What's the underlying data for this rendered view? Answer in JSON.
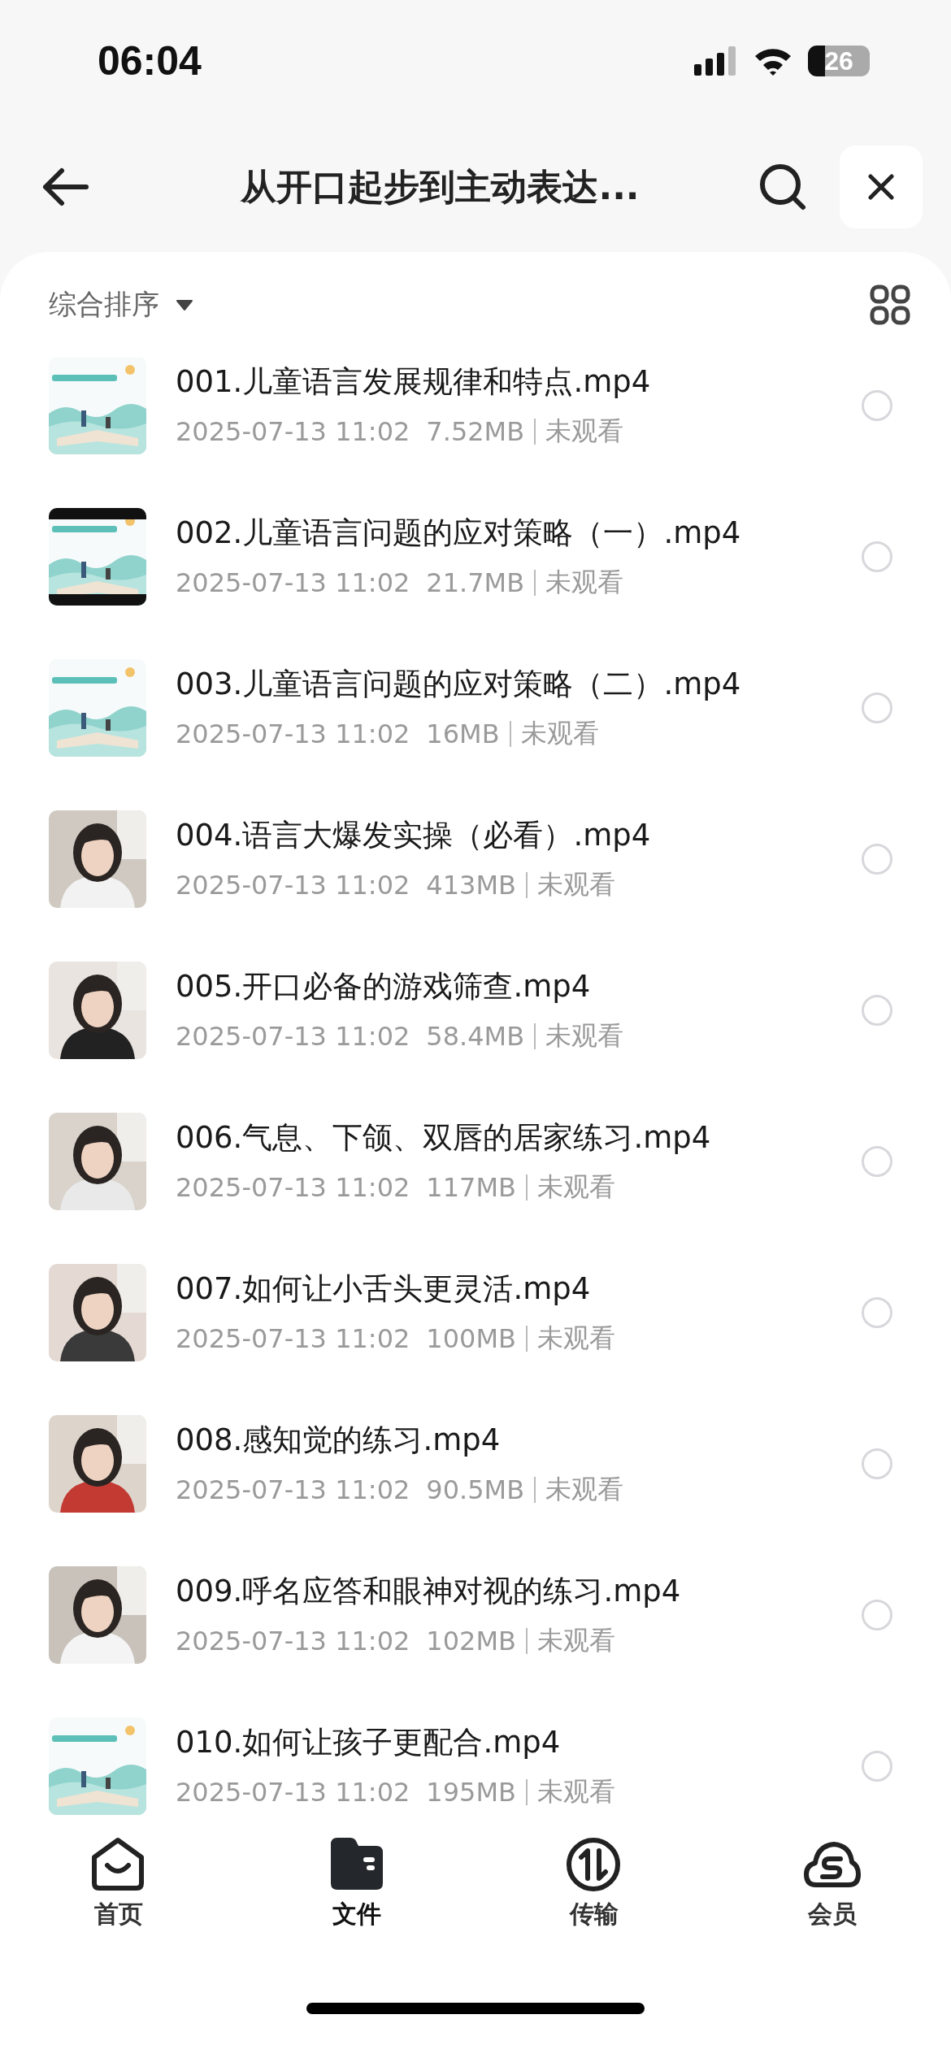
{
  "status_bar": {
    "time": "06:04",
    "battery": "26"
  },
  "header": {
    "title": "从开口起步到主动表达..."
  },
  "sort": {
    "label": "综合排序"
  },
  "files": [
    {
      "name": "001.儿童语言发展规律和特点.mp4",
      "date": "2025-07-13 11:02",
      "size": "7.52MB",
      "status": "未观看",
      "selected": false
    },
    {
      "name": "002.儿童语言问题的应对策略（一）.mp4",
      "date": "2025-07-13 11:02",
      "size": "21.7MB",
      "status": "未观看",
      "selected": false
    },
    {
      "name": "003.儿童语言问题的应对策略（二）.mp4",
      "date": "2025-07-13 11:02",
      "size": "16MB",
      "status": "未观看",
      "selected": false
    },
    {
      "name": "004.语言大爆发实操（必看）.mp4",
      "date": "2025-07-13 11:02",
      "size": "413MB",
      "status": "未观看",
      "selected": false
    },
    {
      "name": "005.开口必备的游戏筛查.mp4",
      "date": "2025-07-13 11:02",
      "size": "58.4MB",
      "status": "未观看",
      "selected": false
    },
    {
      "name": "006.气息、下颌、双唇的居家练习.mp4",
      "date": "2025-07-13 11:02",
      "size": "117MB",
      "status": "未观看",
      "selected": false
    },
    {
      "name": "007.如何让小舌头更灵活.mp4",
      "date": "2025-07-13 11:02",
      "size": "100MB",
      "status": "未观看",
      "selected": false
    },
    {
      "name": "008.感知觉的练习.mp4",
      "date": "2025-07-13 11:02",
      "size": "90.5MB",
      "status": "未观看",
      "selected": false
    },
    {
      "name": "009.呼名应答和眼神对视的练习.mp4",
      "date": "2025-07-13 11:02",
      "size": "102MB",
      "status": "未观看",
      "selected": false
    },
    {
      "name": "010.如何让孩子更配合.mp4",
      "date": "2025-07-13 11:02",
      "size": "195MB",
      "status": "未观看",
      "selected": false
    }
  ],
  "tab_bar": [
    {
      "kind": "home",
      "label": "首页",
      "selected": false
    },
    {
      "kind": "files",
      "label": "文件",
      "selected": true
    },
    {
      "kind": "transfer",
      "label": "传输",
      "selected": false
    },
    {
      "kind": "member",
      "label": "会员",
      "selected": false
    }
  ]
}
